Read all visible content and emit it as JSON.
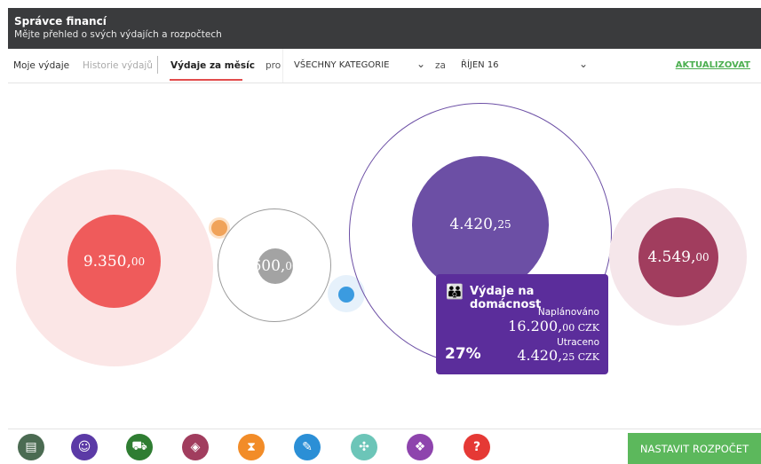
{
  "header": {
    "title": "Správce financí",
    "subtitle": "Mějte přehled o svých výdajích a rozpočtech"
  },
  "nav": {
    "tabs": [
      {
        "label": "Moje výdaje"
      },
      {
        "label": "Historie výdajů"
      },
      {
        "label": "Výdaje za měsíc"
      }
    ],
    "pro_label": "pro",
    "category_value": "VŠECHNY KATEGORIE",
    "za_label": "za",
    "month_value": "ŘÍJEN 16",
    "update_label": "AKTUALIZOVAT"
  },
  "bubbles": [
    {
      "main": "9.350,",
      "dec": "00",
      "color": "#ef5b5b"
    },
    {
      "main": "600,",
      "dec": "00",
      "color": "#a3a3a3"
    },
    {
      "main": "4.420,",
      "dec": "25",
      "color": "#6c4fa5"
    },
    {
      "main": "4.549,",
      "dec": "00",
      "color": "#a13d5e"
    }
  ],
  "tooltip": {
    "title": "Výdaje na domácnost",
    "planned_label": "Naplánováno",
    "planned_main": "16.200,",
    "planned_dec": "00 CZK",
    "spent_label": "Utraceno",
    "spent_main": "4.420,",
    "spent_dec": "25 CZK",
    "percent": "27%"
  },
  "footer": {
    "icons": [
      {
        "name": "wallet-icon",
        "color": "#4b6b52"
      },
      {
        "name": "family-icon",
        "color": "#5b3aa6"
      },
      {
        "name": "car-icon",
        "color": "#2f7d32"
      },
      {
        "name": "ticket-icon",
        "color": "#a13d5e"
      },
      {
        "name": "hourglass-icon",
        "color": "#f28c28"
      },
      {
        "name": "pencil-icon",
        "color": "#2b8fd6"
      },
      {
        "name": "ribbon-icon",
        "color": "#6cc5b8"
      },
      {
        "name": "money-icon",
        "color": "#8e44ad"
      },
      {
        "name": "question-icon",
        "color": "#e53935"
      }
    ],
    "cta_label": "NASTAVIT ROZPOČET"
  }
}
